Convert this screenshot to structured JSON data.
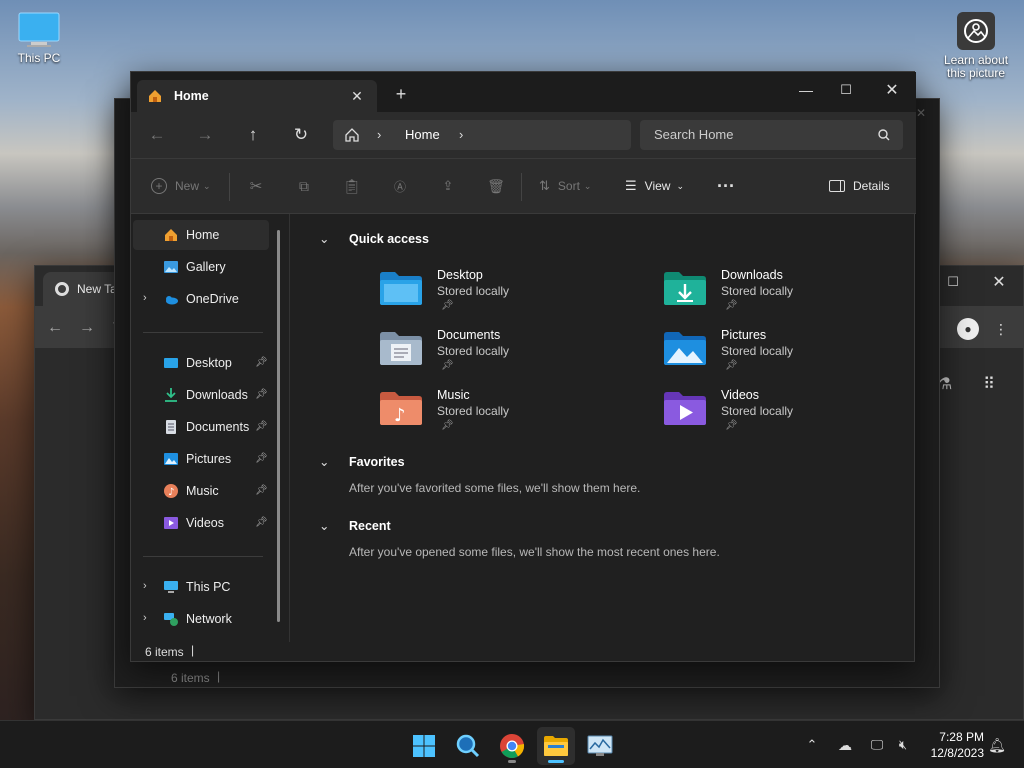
{
  "desktop": {
    "icons": [
      {
        "label": "This PC",
        "name": "this-pc"
      }
    ],
    "learn_label": "Learn about this picture"
  },
  "chrome": {
    "tab_title": "New Tab"
  },
  "back_window": {
    "status": "6 items"
  },
  "explorer": {
    "tab_title": "Home",
    "breadcrumb": {
      "current": "Home"
    },
    "search_placeholder": "Search Home",
    "toolbar": {
      "new_label": "New",
      "sort_label": "Sort",
      "view_label": "View",
      "details_label": "Details"
    },
    "sidebar": {
      "top": [
        {
          "label": "Home"
        },
        {
          "label": "Gallery"
        },
        {
          "label": "OneDrive"
        }
      ],
      "pinned": [
        {
          "label": "Desktop"
        },
        {
          "label": "Downloads"
        },
        {
          "label": "Documents"
        },
        {
          "label": "Pictures"
        },
        {
          "label": "Music"
        },
        {
          "label": "Videos"
        }
      ],
      "bottom": [
        {
          "label": "This PC"
        },
        {
          "label": "Network"
        }
      ]
    },
    "quick_access": {
      "title": "Quick access",
      "items": [
        {
          "name": "Desktop",
          "status": "Stored locally",
          "color": "#29a3e8"
        },
        {
          "name": "Downloads",
          "status": "Stored locally",
          "color": "#1fb29a"
        },
        {
          "name": "Documents",
          "status": "Stored locally",
          "color": "#a0b4c8"
        },
        {
          "name": "Pictures",
          "status": "Stored locally",
          "color": "#1e8fe0"
        },
        {
          "name": "Music",
          "status": "Stored locally",
          "color": "#e8805a"
        },
        {
          "name": "Videos",
          "status": "Stored locally",
          "color": "#8a5ae0"
        }
      ]
    },
    "favorites": {
      "title": "Favorites",
      "empty": "After you've favorited some files, we'll show them here."
    },
    "recent": {
      "title": "Recent",
      "empty": "After you've opened some files, we'll show the most recent ones here."
    },
    "status": "6 items"
  },
  "taskbar": {
    "time": "7:28 PM",
    "date": "12/8/2023"
  },
  "colors": {
    "accent": "#4cc2ff",
    "window_bg": "#202020",
    "selected": "#2d2d2d"
  }
}
